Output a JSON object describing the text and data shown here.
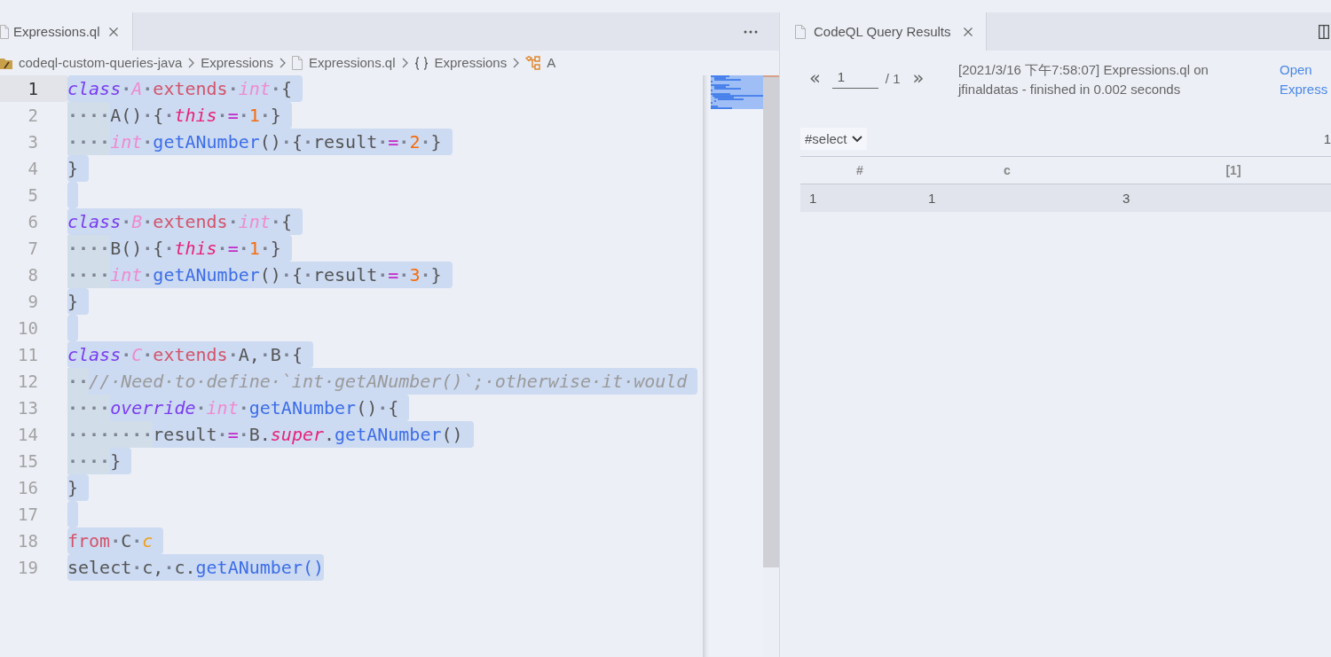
{
  "editor": {
    "tab": {
      "label": "Expressions.ql",
      "selected": true
    },
    "breadcrumbs": [
      {
        "kind": "folder",
        "label": "codeql-custom-queries-java"
      },
      {
        "kind": "plain",
        "label": "Expressions"
      },
      {
        "kind": "file",
        "label": "Expressions.ql"
      },
      {
        "kind": "module",
        "label": "Expressions"
      },
      {
        "kind": "class",
        "label": "A"
      }
    ],
    "lines": [
      {
        "number": "1",
        "current": true,
        "selected": true,
        "tokens": [
          {
            "kind": "keyword",
            "text": "class"
          },
          {
            "kind": "ws",
            "text": "·"
          },
          {
            "kind": "type",
            "text": "A"
          },
          {
            "kind": "ws",
            "text": "·"
          },
          {
            "kind": "keyword2",
            "text": "extends"
          },
          {
            "kind": "ws",
            "text": "·"
          },
          {
            "kind": "type",
            "text": "int"
          },
          {
            "kind": "ws",
            "text": "·"
          },
          {
            "kind": "plain",
            "text": "{"
          }
        ]
      },
      {
        "number": "2",
        "current": false,
        "selected": true,
        "tokens": [
          {
            "kind": "indent",
            "text": "····"
          },
          {
            "kind": "plain",
            "text": "A()"
          },
          {
            "kind": "ws",
            "text": "·"
          },
          {
            "kind": "plain",
            "text": "{"
          },
          {
            "kind": "ws",
            "text": "·"
          },
          {
            "kind": "special",
            "text": "this"
          },
          {
            "kind": "ws",
            "text": "·"
          },
          {
            "kind": "operator",
            "text": "="
          },
          {
            "kind": "ws",
            "text": "·"
          },
          {
            "kind": "number",
            "text": "1"
          },
          {
            "kind": "ws",
            "text": "·"
          },
          {
            "kind": "plain",
            "text": "}"
          }
        ]
      },
      {
        "number": "3",
        "current": false,
        "selected": true,
        "tokens": [
          {
            "kind": "indent",
            "text": "····"
          },
          {
            "kind": "type",
            "text": "int"
          },
          {
            "kind": "ws",
            "text": "·"
          },
          {
            "kind": "function",
            "text": "getANumber"
          },
          {
            "kind": "plain",
            "text": "()"
          },
          {
            "kind": "ws",
            "text": "·"
          },
          {
            "kind": "plain",
            "text": "{"
          },
          {
            "kind": "ws",
            "text": "·"
          },
          {
            "kind": "plain",
            "text": "result"
          },
          {
            "kind": "ws",
            "text": "·"
          },
          {
            "kind": "operator",
            "text": "="
          },
          {
            "kind": "ws",
            "text": "·"
          },
          {
            "kind": "number",
            "text": "2"
          },
          {
            "kind": "ws",
            "text": "·"
          },
          {
            "kind": "plain",
            "text": "}"
          }
        ]
      },
      {
        "number": "4",
        "current": false,
        "selected": true,
        "tokens": [
          {
            "kind": "plain",
            "text": "}"
          }
        ]
      },
      {
        "number": "5",
        "current": false,
        "selected": true
      },
      {
        "number": "6",
        "current": false,
        "selected": true,
        "tokens": [
          {
            "kind": "keyword",
            "text": "class"
          },
          {
            "kind": "ws",
            "text": "·"
          },
          {
            "kind": "type",
            "text": "B"
          },
          {
            "kind": "ws",
            "text": "·"
          },
          {
            "kind": "keyword2",
            "text": "extends"
          },
          {
            "kind": "ws",
            "text": "·"
          },
          {
            "kind": "type",
            "text": "int"
          },
          {
            "kind": "ws",
            "text": "·"
          },
          {
            "kind": "plain",
            "text": "{"
          }
        ]
      },
      {
        "number": "7",
        "current": false,
        "selected": true,
        "tokens": [
          {
            "kind": "indent",
            "text": "····"
          },
          {
            "kind": "plain",
            "text": "B()"
          },
          {
            "kind": "ws",
            "text": "·"
          },
          {
            "kind": "plain",
            "text": "{"
          },
          {
            "kind": "ws",
            "text": "·"
          },
          {
            "kind": "special",
            "text": "this"
          },
          {
            "kind": "ws",
            "text": "·"
          },
          {
            "kind": "operator",
            "text": "="
          },
          {
            "kind": "ws",
            "text": "·"
          },
          {
            "kind": "number",
            "text": "1"
          },
          {
            "kind": "ws",
            "text": "·"
          },
          {
            "kind": "plain",
            "text": "}"
          }
        ]
      },
      {
        "number": "8",
        "current": false,
        "selected": true,
        "tokens": [
          {
            "kind": "indent",
            "text": "····"
          },
          {
            "kind": "type",
            "text": "int"
          },
          {
            "kind": "ws",
            "text": "·"
          },
          {
            "kind": "function",
            "text": "getANumber"
          },
          {
            "kind": "plain",
            "text": "()"
          },
          {
            "kind": "ws",
            "text": "·"
          },
          {
            "kind": "plain",
            "text": "{"
          },
          {
            "kind": "ws",
            "text": "·"
          },
          {
            "kind": "plain",
            "text": "result"
          },
          {
            "kind": "ws",
            "text": "·"
          },
          {
            "kind": "operator",
            "text": "="
          },
          {
            "kind": "ws",
            "text": "·"
          },
          {
            "kind": "number",
            "text": "3"
          },
          {
            "kind": "ws",
            "text": "·"
          },
          {
            "kind": "plain",
            "text": "}"
          }
        ]
      },
      {
        "number": "9",
        "current": false,
        "selected": true,
        "tokens": [
          {
            "kind": "plain",
            "text": "}"
          }
        ]
      },
      {
        "number": "10",
        "current": false,
        "selected": true
      },
      {
        "number": "11",
        "current": false,
        "selected": true,
        "tokens": [
          {
            "kind": "keyword",
            "text": "class"
          },
          {
            "kind": "ws",
            "text": "·"
          },
          {
            "kind": "type",
            "text": "C"
          },
          {
            "kind": "ws",
            "text": "·"
          },
          {
            "kind": "keyword2",
            "text": "extends"
          },
          {
            "kind": "ws",
            "text": "·"
          },
          {
            "kind": "plain",
            "text": "A,"
          },
          {
            "kind": "ws",
            "text": "·"
          },
          {
            "kind": "plain",
            "text": "B"
          },
          {
            "kind": "ws",
            "text": "·"
          },
          {
            "kind": "plain",
            "text": "{"
          }
        ]
      },
      {
        "number": "12",
        "current": false,
        "selected": true,
        "tokens": [
          {
            "kind": "indent",
            "text": "··"
          },
          {
            "kind": "comment",
            "text": "//·Need·to·define·`int·getANumber()`;·otherwise·it·would"
          }
        ]
      },
      {
        "number": "13",
        "current": false,
        "selected": true,
        "tokens": [
          {
            "kind": "indent",
            "text": "····"
          },
          {
            "kind": "keyword",
            "text": "override"
          },
          {
            "kind": "ws",
            "text": "·"
          },
          {
            "kind": "type",
            "text": "int"
          },
          {
            "kind": "ws",
            "text": "·"
          },
          {
            "kind": "function",
            "text": "getANumber"
          },
          {
            "kind": "plain",
            "text": "()"
          },
          {
            "kind": "ws",
            "text": "·"
          },
          {
            "kind": "plain",
            "text": "{"
          }
        ]
      },
      {
        "number": "14",
        "current": false,
        "selected": true,
        "tokens": [
          {
            "kind": "indent",
            "text": "········"
          },
          {
            "kind": "plain",
            "text": "result"
          },
          {
            "kind": "ws",
            "text": "·"
          },
          {
            "kind": "operator",
            "text": "="
          },
          {
            "kind": "ws",
            "text": "·"
          },
          {
            "kind": "plain",
            "text": "B."
          },
          {
            "kind": "special",
            "text": "super"
          },
          {
            "kind": "plain",
            "text": "."
          },
          {
            "kind": "function",
            "text": "getANumber"
          },
          {
            "kind": "plain",
            "text": "()"
          }
        ]
      },
      {
        "number": "15",
        "current": false,
        "selected": true,
        "tokens": [
          {
            "kind": "indent",
            "text": "····"
          },
          {
            "kind": "plain",
            "text": "}"
          }
        ]
      },
      {
        "number": "16",
        "current": false,
        "selected": true,
        "tokens": [
          {
            "kind": "plain",
            "text": "}"
          }
        ]
      },
      {
        "number": "17",
        "current": false,
        "selected": true
      },
      {
        "number": "18",
        "current": false,
        "selected": true,
        "tokens": [
          {
            "kind": "keyword2",
            "text": "from"
          },
          {
            "kind": "ws",
            "text": "·"
          },
          {
            "kind": "plain",
            "text": "C"
          },
          {
            "kind": "ws",
            "text": "·"
          },
          {
            "kind": "variable",
            "text": "c"
          }
        ]
      },
      {
        "number": "19",
        "current": false,
        "selected": true,
        "tokens": [
          {
            "kind": "plain",
            "text": "select"
          },
          {
            "kind": "ws",
            "text": "·"
          },
          {
            "kind": "plain",
            "text": "c,"
          },
          {
            "kind": "ws",
            "text": "·"
          },
          {
            "kind": "plain",
            "text": "c."
          },
          {
            "kind": "function",
            "text": "getANumber()"
          }
        ]
      }
    ]
  },
  "results": {
    "tab": {
      "label": "CodeQL Query Results",
      "selected": true
    },
    "pager": {
      "previous": "«",
      "page": "1",
      "total": "/ 1",
      "next": "»"
    },
    "message": "[2021/3/16 下午7:58:07] Expressions.ql on jfinaldatas - finished in 0.002 seconds",
    "link": "Open Express",
    "result_set": "#select",
    "result_count": "1",
    "table": {
      "columns": [
        "#",
        "c",
        "[1]"
      ],
      "rows": [
        [
          "1",
          "1",
          "3"
        ]
      ]
    }
  }
}
